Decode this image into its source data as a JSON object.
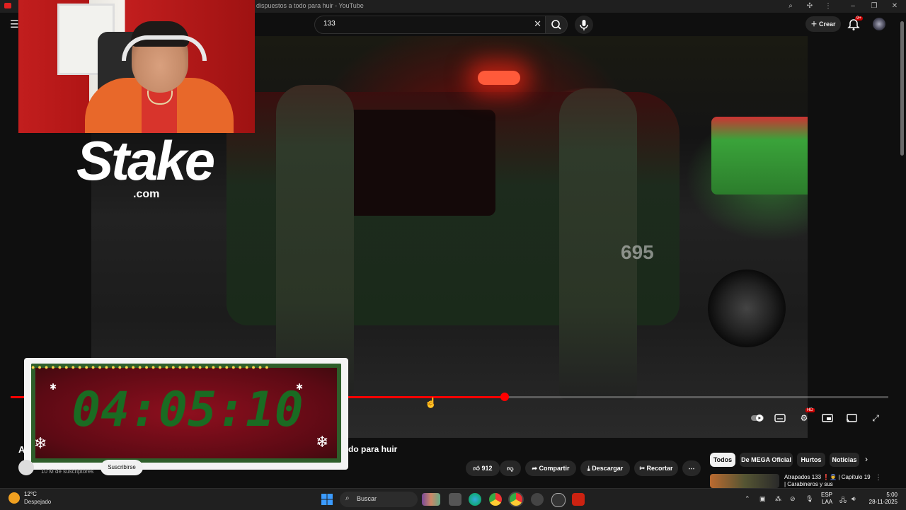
{
  "window": {
    "title_visible": "es dispuestos a todo para huir - YouTube"
  },
  "header": {
    "search_value": "133",
    "create_label": "Crear",
    "notification_badge": "9+"
  },
  "overlay": {
    "brand": "Stake",
    "brand_suffix": ".com",
    "timer": "04:05:10"
  },
  "player": {
    "hd_badge": "HD",
    "car_number": "695"
  },
  "video": {
    "title_start": "A",
    "title_end": "do para huir",
    "subscribers": "10 M de suscriptores",
    "subscribe_label": "Suscribirse",
    "likes": "912",
    "share_label": "Compartir",
    "download_label": "Descargar",
    "clip_label": "Recortar"
  },
  "chips": [
    "Todos",
    "De MEGA Oficial",
    "Hurtos",
    "Noticias"
  ],
  "recommendation": {
    "title": "Atrapados 133 ❗👮 | Capítulo 19 | Carabineros y sus"
  },
  "taskbar": {
    "weather_temp": "12°C",
    "weather_desc": "Despejado",
    "search_label": "Buscar",
    "lang_1": "ESP",
    "lang_2": "LAA",
    "time": "5:00",
    "date": "28-11-2025"
  },
  "colors": {
    "accent": "#ff0000",
    "background": "#0f0f0f",
    "timer_digits": "#1a6b22"
  }
}
